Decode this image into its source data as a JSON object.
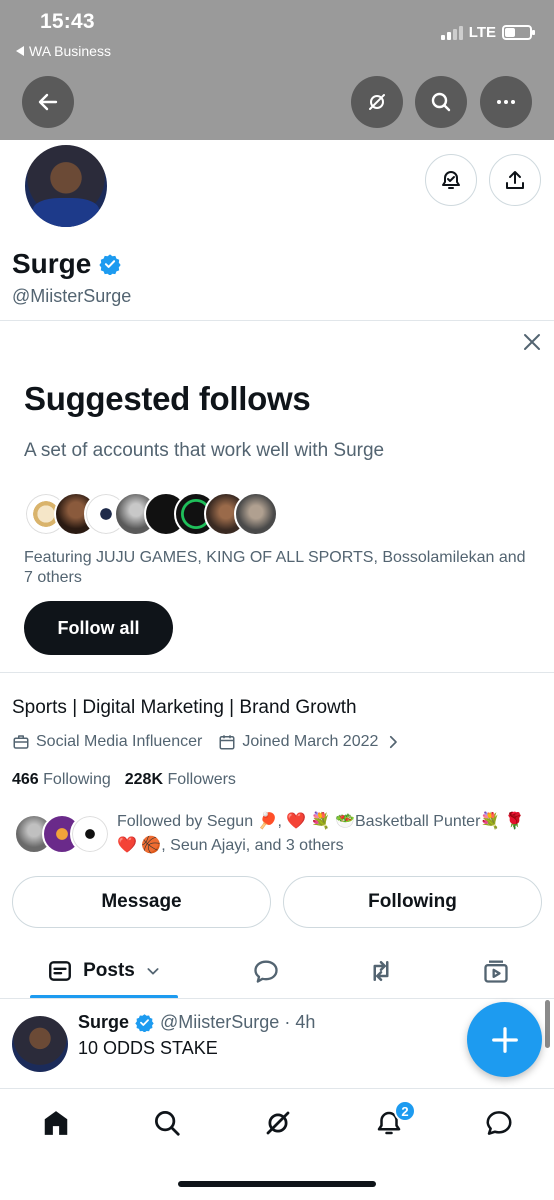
{
  "status_bar": {
    "time": "15:43",
    "back_app": "WA Business",
    "network": "LTE"
  },
  "profile": {
    "name": "Surge",
    "handle": "@MiisterSurge",
    "bio": "Sports | Digital Marketing | Brand Growth",
    "category": "Social Media Influencer",
    "joined": "Joined March 2022",
    "following_count": "466",
    "following_label": "Following",
    "followers_count": "228K",
    "followers_label": "Followers",
    "followed_by": "Followed by Segun 🏓, ❤️ 💐 🥗Basketball Punter💐 🌹 ❤️ 🏀, Seun Ajayi, and 3 others"
  },
  "suggested": {
    "title": "Suggested follows",
    "subtitle": "A set of accounts that work well with Surge",
    "featuring": "Featuring JUJU GAMES, KING OF ALL SPORTS, Bossolamilekan and 7 others",
    "follow_all_label": "Follow all"
  },
  "actions": {
    "message_label": "Message",
    "following_label": "Following"
  },
  "tabs": {
    "posts_label": "Posts"
  },
  "post": {
    "author": "Surge",
    "handle_time": "@MiisterSurge · 4h",
    "text": "10 ODDS STAKE"
  },
  "nav": {
    "notification_badge": "2"
  },
  "colors": {
    "accent": "#1d9bf0",
    "dark": "#0f1419",
    "secondary_text": "#536471",
    "banner": "#9a9a9a"
  },
  "icons": [
    "back-arrow-icon",
    "grok-icon",
    "search-icon",
    "more-icon",
    "notification-bell-icon",
    "share-icon",
    "verified-badge-icon",
    "close-icon",
    "briefcase-icon",
    "calendar-icon",
    "chevron-right-icon",
    "posts-icon",
    "chevron-down-icon",
    "reply-icon",
    "repost-icon",
    "media-icon",
    "plus-icon",
    "home-icon",
    "bell-icon",
    "chat-icon"
  ]
}
